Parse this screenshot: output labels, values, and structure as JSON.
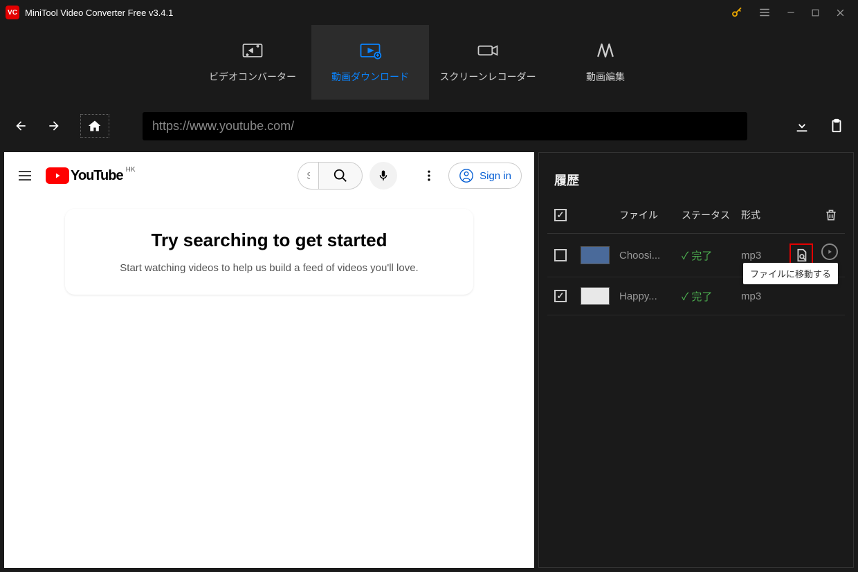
{
  "titlebar": {
    "title": "MiniTool Video Converter Free v3.4.1"
  },
  "tabs": {
    "converter": "ビデオコンバーター",
    "download": "動画ダウンロード",
    "recorder": "スクリーンレコーダー",
    "edit": "動画編集"
  },
  "url": "https://www.youtube.com/",
  "youtube": {
    "brand": "YouTube",
    "region": "HK",
    "search_value": "S",
    "signin": "Sign in",
    "card_title": "Try searching to get started",
    "card_body": "Start watching videos to help us build a feed of videos you'll love."
  },
  "history": {
    "title": "履歴",
    "col_file": "ファイル",
    "col_status": "ステータス",
    "col_format": "形式",
    "rows": [
      {
        "checked": false,
        "file": "Choosi...",
        "status": "✓ 完了",
        "format": "mp3"
      },
      {
        "checked": true,
        "file": "Happy...",
        "status": "✓ 完了",
        "format": "mp3"
      }
    ],
    "tooltip": "ファイルに移動する"
  }
}
